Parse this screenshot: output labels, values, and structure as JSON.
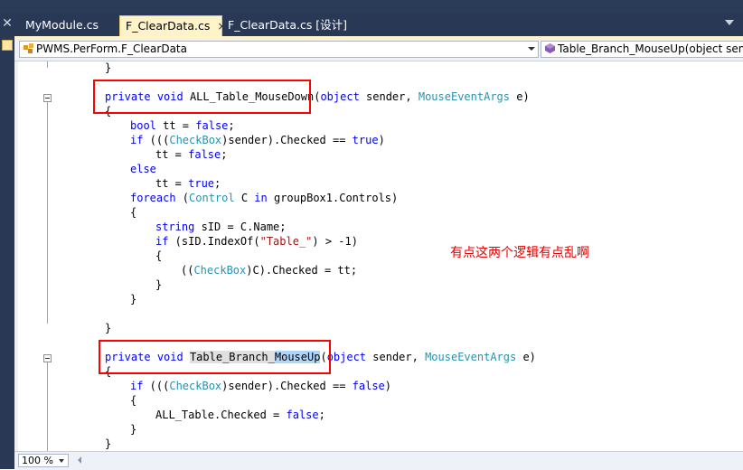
{
  "tabs": [
    {
      "label": "MyModule.cs",
      "active": false
    },
    {
      "label": "F_ClearData.cs",
      "active": true
    },
    {
      "label": "F_ClearData.cs [设计]",
      "active": false
    }
  ],
  "tab_close_glyph": "×",
  "panel_close_glyph": "✕",
  "nav": {
    "class_combo": "PWMS.PerForm.F_ClearData",
    "member_combo": "Table_Branch_MouseUp(object sen"
  },
  "code": {
    "l1": "}",
    "l3_kw1": "private",
    "l3_kw2": "void",
    "l3_name": "ALL_Table_MouseDown(",
    "l3_kw3": "object",
    "l3_mid": " sender, ",
    "l3_ty": "MouseEventArgs",
    "l3_end": " e)",
    "l4": "{",
    "l5_kw1": "bool",
    "l5_mid": " tt = ",
    "l5_kw2": "false",
    "l5_end": ";",
    "l6_kw": "if",
    "l6_a": " (((",
    "l6_ty": "CheckBox",
    "l6_b": ")sender).Checked == ",
    "l6_kw2": "true",
    "l6_c": ")",
    "l7_a": "tt = ",
    "l7_kw": "false",
    "l7_b": ";",
    "l8_kw": "else",
    "l9_a": "tt = ",
    "l9_kw": "true",
    "l9_b": ";",
    "l10_kw": "foreach",
    "l10_a": " (",
    "l10_ty": "Control",
    "l10_b": " C ",
    "l10_kw2": "in",
    "l10_c": " groupBox1.Controls)",
    "l11": "{",
    "l12_kw": "string",
    "l12_a": " sID = C.Name;",
    "l13_kw": "if",
    "l13_a": " (sID.IndexOf(",
    "l13_st": "\"Table_\"",
    "l13_b": ") > -1)",
    "l14": "{",
    "l15_a": "((",
    "l15_ty": "CheckBox",
    "l15_b": ")C).Checked = tt;",
    "l16": "}",
    "l17": "}",
    "l19": "}",
    "l21_kw1": "private",
    "l21_kw2": "void",
    "l21_name1": "Table_Branch_",
    "l21_name2": "MouseUp",
    "l21_paren": "(",
    "l21_kw3": "object",
    "l21_mid": " sender, ",
    "l21_ty": "MouseEventArgs",
    "l21_end": " e)",
    "l22": "{",
    "l23_kw": "if",
    "l23_a": " (((",
    "l23_ty": "CheckBox",
    "l23_b": ")sender).Checked == ",
    "l23_kw2": "false",
    "l23_c": ")",
    "l24": "{",
    "l25_a": "ALL_Table.Checked = ",
    "l25_kw": "false",
    "l25_b": ";",
    "l26": "}",
    "l27": "}"
  },
  "annotation": "有点这两个逻辑有点乱啊",
  "zoom": "100 %",
  "colors": {
    "keyword": "#0000ff",
    "type": "#2b91af",
    "string": "#a31515",
    "annotation": "#e60000",
    "tab_active": "#fff3c9",
    "chrome": "#293955"
  }
}
